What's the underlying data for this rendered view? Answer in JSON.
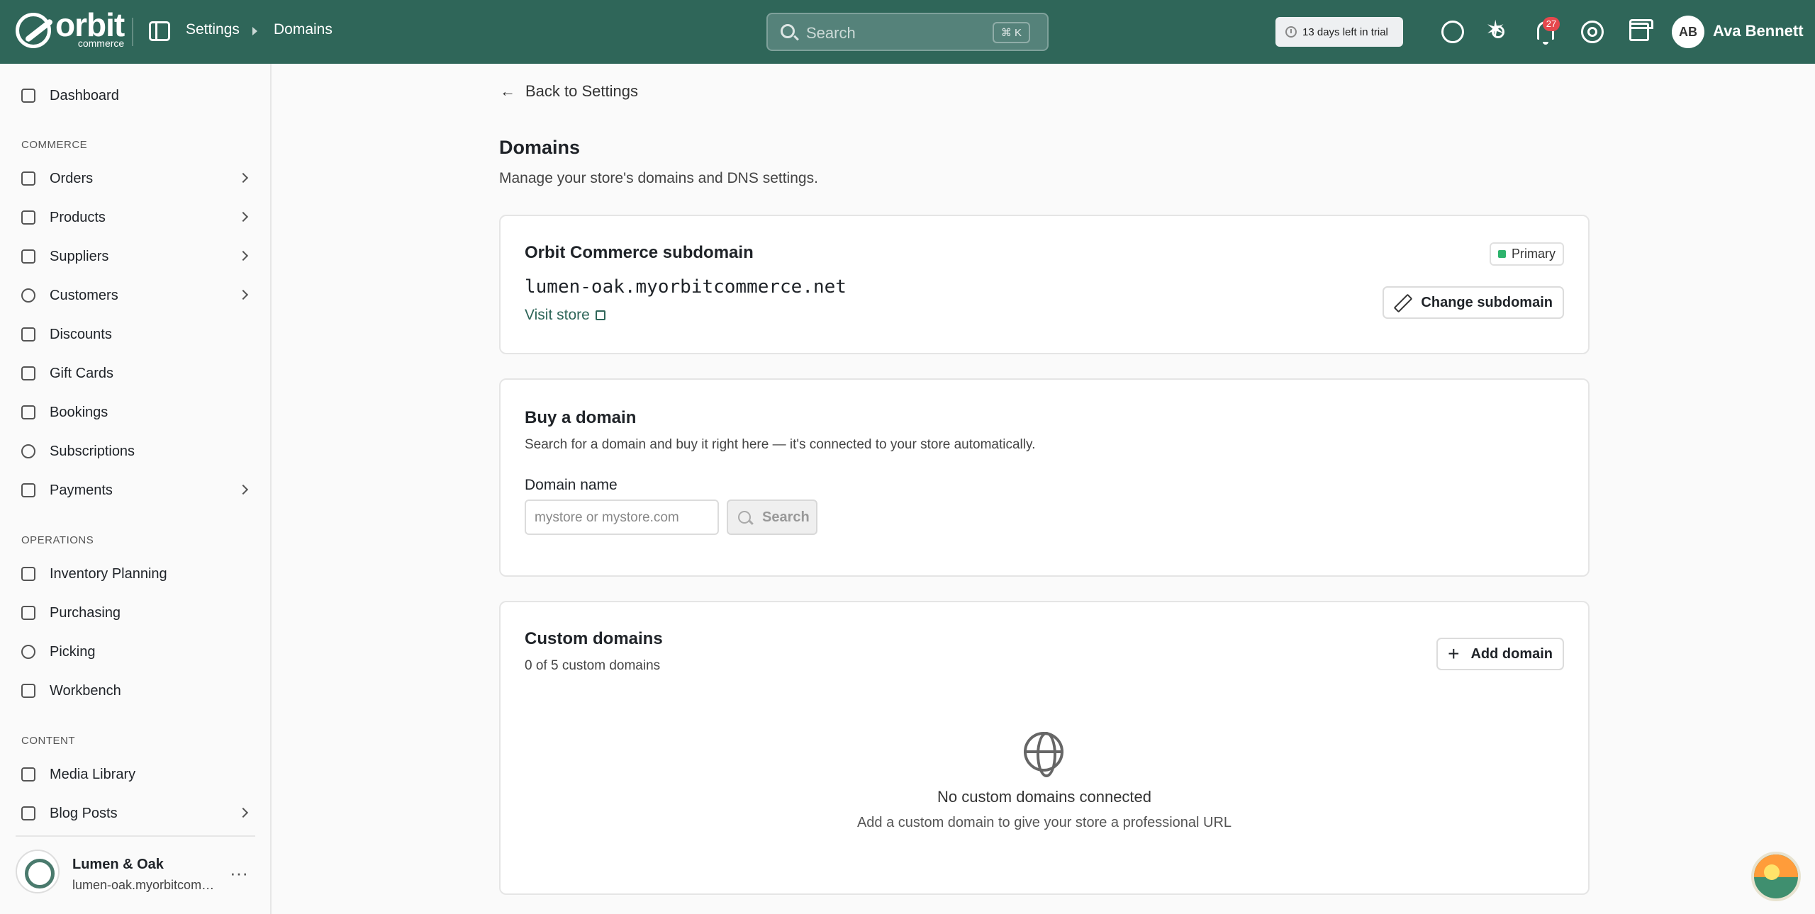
{
  "brand": {
    "name": "orbit",
    "sub": "commerce"
  },
  "breadcrumb": {
    "parent": "Settings",
    "current": "Domains"
  },
  "search": {
    "placeholder": "Search",
    "shortcut": "⌘ K"
  },
  "trial": {
    "text": "13 days left in trial"
  },
  "notifications": {
    "count": "27"
  },
  "user": {
    "initials": "AB",
    "name": "Ava Bennett"
  },
  "sidebar": {
    "dashboard": "Dashboard",
    "sections": {
      "commerce": "COMMERCE",
      "operations": "OPERATIONS",
      "content": "CONTENT"
    },
    "items": {
      "orders": "Orders",
      "products": "Products",
      "suppliers": "Suppliers",
      "customers": "Customers",
      "discounts": "Discounts",
      "gift_cards": "Gift Cards",
      "bookings": "Bookings",
      "subscriptions": "Subscriptions",
      "payments": "Payments",
      "inventory_planning": "Inventory Planning",
      "purchasing": "Purchasing",
      "picking": "Picking",
      "workbench": "Workbench",
      "media_library": "Media Library",
      "blog_posts": "Blog Posts"
    },
    "store": {
      "name": "Lumen & Oak",
      "url": "lumen-oak.myorbitcommerce.net"
    }
  },
  "main": {
    "back_label": "Back to Settings",
    "title": "Domains",
    "subtitle": "Manage your store's domains and DNS settings.",
    "subdomain_card": {
      "title": "Orbit Commerce subdomain",
      "domain": "lumen-oak.myorbitcommerce.net",
      "visit_label": "Visit store",
      "badge": "Primary",
      "change_button": "Change subdomain"
    },
    "buy_card": {
      "title": "Buy a domain",
      "description": "Search for a domain and buy it right here — it's connected to your store automatically.",
      "field_label": "Domain name",
      "input_placeholder": "mystore or mystore.com",
      "search_button": "Search"
    },
    "custom_card": {
      "title": "Custom domains",
      "count": "0 of 5 custom domains",
      "add_button": "Add domain",
      "empty_title": "No custom domains connected",
      "empty_sub": "Add a custom domain to give your store a professional URL"
    }
  }
}
